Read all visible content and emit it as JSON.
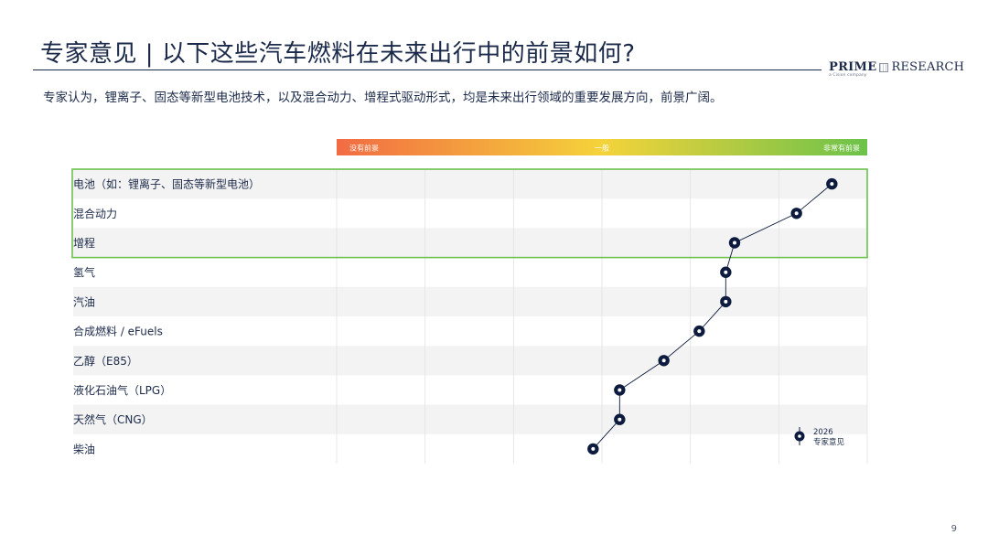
{
  "slide": {
    "title": "专家意见 | 以下这些汽车燃料在未来出行中的前景如何?",
    "subtitle": "专家认为，锂离子、固态等新型电池技术，以及混合动力、增程式驱动形式，均是未来出行领域的重要发展方向，前景广阔。",
    "page_number": "9"
  },
  "logo": {
    "prime": "PRIME",
    "research": "RESEARCH",
    "tagline": "a Cision company"
  },
  "colors": {
    "navy": "#0d1b3e",
    "scale_low": "#f26b43",
    "scale_mid": "#f5d33a",
    "scale_high": "#6cc24a",
    "highlight_border": "#6cc24a",
    "row_shade": "#f3f3f3"
  },
  "chart_data": {
    "type": "scatter",
    "title": "",
    "scale_labels": {
      "low": "没有前景",
      "mid": "一般",
      "high": "非常有前景"
    },
    "x_range": [
      0,
      6
    ],
    "categories": [
      "电池（如：锂离子、固态等新型电池）",
      "混合动力",
      "增程",
      "氢气",
      "汽油",
      "合成燃料 / eFuels",
      "乙醇（E85）",
      "液化石油气（LPG）",
      "天然气（CNG）",
      "柴油"
    ],
    "series": [
      {
        "name": "2026 专家意见",
        "values": [
          5.6,
          5.2,
          4.5,
          4.4,
          4.4,
          4.1,
          3.7,
          3.2,
          3.2,
          2.9
        ]
      }
    ],
    "highlighted_categories": [
      "电池（如：锂离子、固态等新型电池）",
      "混合动力",
      "增程"
    ],
    "legend": {
      "line1": "2026",
      "line2": "专家意见",
      "position": "bottom-right"
    },
    "connected": true,
    "grid": true
  }
}
